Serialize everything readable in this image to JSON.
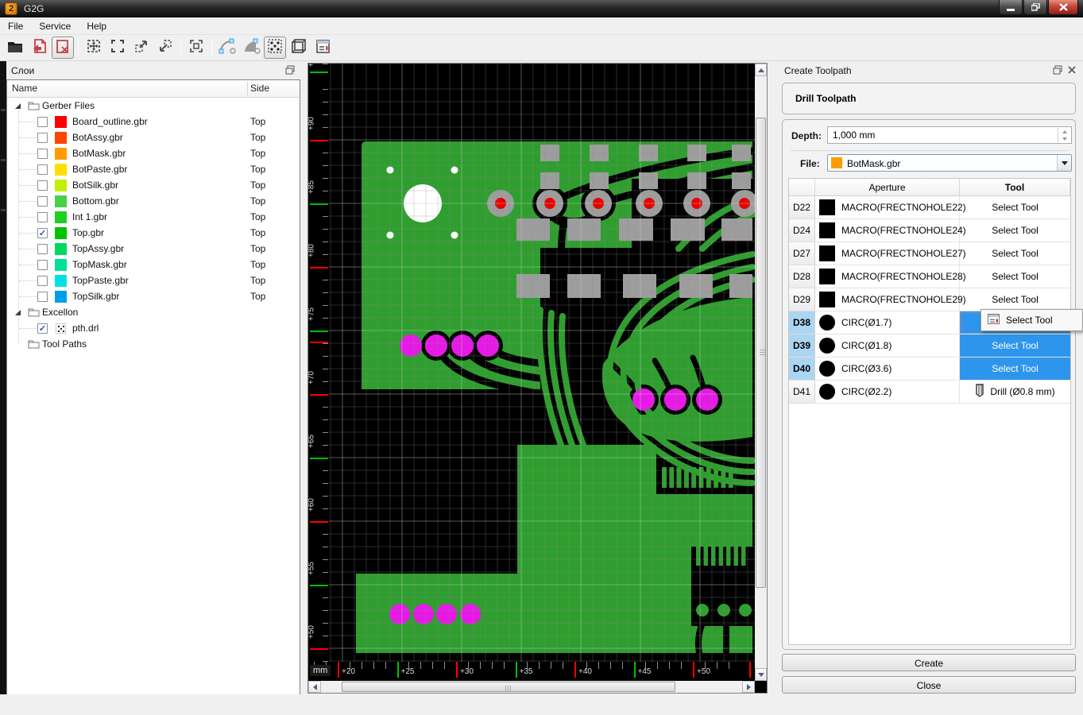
{
  "window": {
    "title": "G2G",
    "caption_buttons": [
      "minimize-button",
      "restore-button",
      "close-button"
    ]
  },
  "menu": [
    "File",
    "Service",
    "Help"
  ],
  "toolbar": {
    "items": [
      {
        "icon": "open-file-icon"
      },
      {
        "icon": "import-gerber-icon"
      },
      {
        "icon": "close-file-icon",
        "pressed": true
      },
      {
        "sep": true
      },
      {
        "icon": "zoom-fit-icon"
      },
      {
        "icon": "zoom-window-icon"
      },
      {
        "icon": "zoom-in-icon"
      },
      {
        "icon": "zoom-out-icon"
      },
      {
        "sep": true
      },
      {
        "icon": "snap-markers-icon"
      },
      {
        "sep": true
      },
      {
        "icon": "arc-tool-icon"
      },
      {
        "icon": "arc-fill-tool-icon"
      },
      {
        "icon": "drill-points-icon",
        "pressed": true
      },
      {
        "icon": "board-3d-icon"
      },
      {
        "icon": "properties-icon"
      }
    ]
  },
  "layers_panel": {
    "title": "Слои",
    "columns": [
      "Name",
      "Side"
    ],
    "tree": [
      {
        "type": "folder",
        "label": "Gerber Files",
        "expanded": true
      },
      {
        "type": "layer",
        "label": "Board_outline.gbr",
        "color": "#ff0000",
        "side": "Top",
        "checked": false
      },
      {
        "type": "layer",
        "label": "BotAssy.gbr",
        "color": "#ff4300",
        "side": "Top",
        "checked": false
      },
      {
        "type": "layer",
        "label": "BotMask.gbr",
        "color": "#ff9c00",
        "side": "Top",
        "checked": false
      },
      {
        "type": "layer",
        "label": "BotPaste.gbr",
        "color": "#ffdf00",
        "side": "Top",
        "checked": false
      },
      {
        "type": "layer",
        "label": "BotSilk.gbr",
        "color": "#c3ef00",
        "side": "Top",
        "checked": false
      },
      {
        "type": "layer",
        "label": "Bottom.gbr",
        "color": "#47d147",
        "side": "Top",
        "checked": false
      },
      {
        "type": "layer",
        "label": "Int 1.gbr",
        "color": "#21cf21",
        "side": "Top",
        "checked": false
      },
      {
        "type": "layer",
        "label": "Top.gbr",
        "color": "#00c400",
        "side": "Top",
        "checked": true
      },
      {
        "type": "layer",
        "label": "TopAssy.gbr",
        "color": "#00d95e",
        "side": "Top",
        "checked": false
      },
      {
        "type": "layer",
        "label": "TopMask.gbr",
        "color": "#00e096",
        "side": "Top",
        "checked": false
      },
      {
        "type": "layer",
        "label": "TopPaste.gbr",
        "color": "#00e2e2",
        "side": "Top",
        "checked": false
      },
      {
        "type": "layer",
        "label": "TopSilk.gbr",
        "color": "#009ded",
        "side": "Top",
        "checked": false
      },
      {
        "type": "folder",
        "label": "Excellon",
        "expanded": true
      },
      {
        "type": "drill",
        "label": "pth.drl",
        "checked": true
      },
      {
        "type": "folder",
        "label": "Tool Paths",
        "expanded": false
      }
    ]
  },
  "rulers": {
    "unit": "mm",
    "origin_plus": "+",
    "vertical": [
      "+90",
      "+85",
      "+80",
      "+75",
      "+70",
      "+65",
      "+60",
      "+55",
      "+50"
    ],
    "horizontal": [
      "+20",
      "+25",
      "+30",
      "+35",
      "+40",
      "+45",
      "+50"
    ]
  },
  "toolpath_panel": {
    "title": "Create Toolpath",
    "section_title": "Drill Toolpath",
    "depth_label": "Depth:",
    "depth_value": "1,000 mm",
    "file_label": "File:",
    "file_value": "BotMask.gbr",
    "file_swatch_color": "#ff9c00",
    "table": {
      "columns": [
        "",
        "Aperture",
        "Tool"
      ],
      "rows": [
        {
          "id": "D22",
          "shape": "square",
          "aperture": "MACRO(FRECTNOHOLE22)",
          "tool": "Select Tool",
          "state": "normal"
        },
        {
          "id": "D24",
          "shape": "square",
          "aperture": "MACRO(FRECTNOHOLE24)",
          "tool": "Select Tool",
          "state": "normal"
        },
        {
          "id": "D27",
          "shape": "square",
          "aperture": "MACRO(FRECTNOHOLE27)",
          "tool": "Select Tool",
          "state": "normal"
        },
        {
          "id": "D28",
          "shape": "square",
          "aperture": "MACRO(FRECTNOHOLE28)",
          "tool": "Select Tool",
          "state": "normal"
        },
        {
          "id": "D29",
          "shape": "square",
          "aperture": "MACRO(FRECTNOHOLE29)",
          "tool": "Select Tool",
          "state": "normal"
        },
        {
          "id": "D38",
          "shape": "circle",
          "aperture": "CIRC(Ø1.7)",
          "tool": "",
          "state": "focused"
        },
        {
          "id": "D39",
          "shape": "circle",
          "aperture": "CIRC(Ø1.8)",
          "tool": "Select Tool",
          "state": "selected"
        },
        {
          "id": "D40",
          "shape": "circle",
          "aperture": "CIRC(Ø3.6)",
          "tool": "Select Tool",
          "state": "selected"
        },
        {
          "id": "D41",
          "shape": "circle",
          "aperture": "CIRC(Ø2.2)",
          "tool": "Drill (Ø0.8 mm)",
          "state": "drill"
        }
      ]
    },
    "create_label": "Create",
    "close_label": "Close"
  },
  "popup_menu": {
    "label": "Select Tool",
    "icon": "select-tool-icon"
  },
  "colors": {
    "selection_blue": "#2e95ec",
    "pcb_green": "#2f9e2f",
    "pad_magenta": "#e619e6",
    "drill_red": "#e80000",
    "tick_red": "#ff0000",
    "tick_green": "#00c000"
  }
}
